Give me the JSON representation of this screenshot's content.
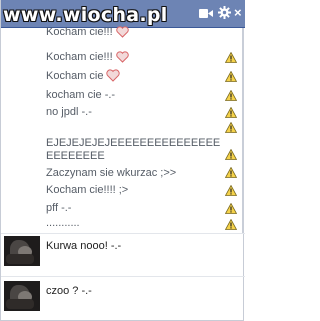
{
  "watermark": "www.wiocha.pl",
  "messages": [
    {
      "text": "Kocham cie!!!",
      "heart": true,
      "warn": false
    },
    {
      "text": "Kocham cie!!!",
      "heart": true,
      "warn": true
    },
    {
      "text": "Kocham cie",
      "heart": true,
      "warn": true
    },
    {
      "text": "kocham cie -.-",
      "heart": false,
      "warn": true
    },
    {
      "text": "no jpdl -.-",
      "heart": false,
      "warn": true
    },
    {
      "text": "EJEJEJEJEJEEEEEEEEEEEEEEEEEEEEEEE",
      "heart": false,
      "warn": true
    },
    {
      "text": "Zaczynam sie wkurzac ;>>",
      "heart": false,
      "warn": true
    },
    {
      "text": "Kocham cie!!!! ;>",
      "heart": false,
      "warn": true
    },
    {
      "text": "pff -.-",
      "heart": false,
      "warn": true
    },
    {
      "text": "...........",
      "heart": false,
      "warn": true
    }
  ],
  "replies": [
    {
      "text": "Kurwa nooo! -.-"
    },
    {
      "text": "czoo ? -.-"
    }
  ],
  "colors": {
    "titlebar": "#6d84b4",
    "warning": "#f5c518",
    "heart": "#e0686a"
  },
  "icons": [
    "video-icon",
    "gear-icon",
    "close-icon",
    "heart-icon",
    "warning-icon",
    "avatar"
  ]
}
